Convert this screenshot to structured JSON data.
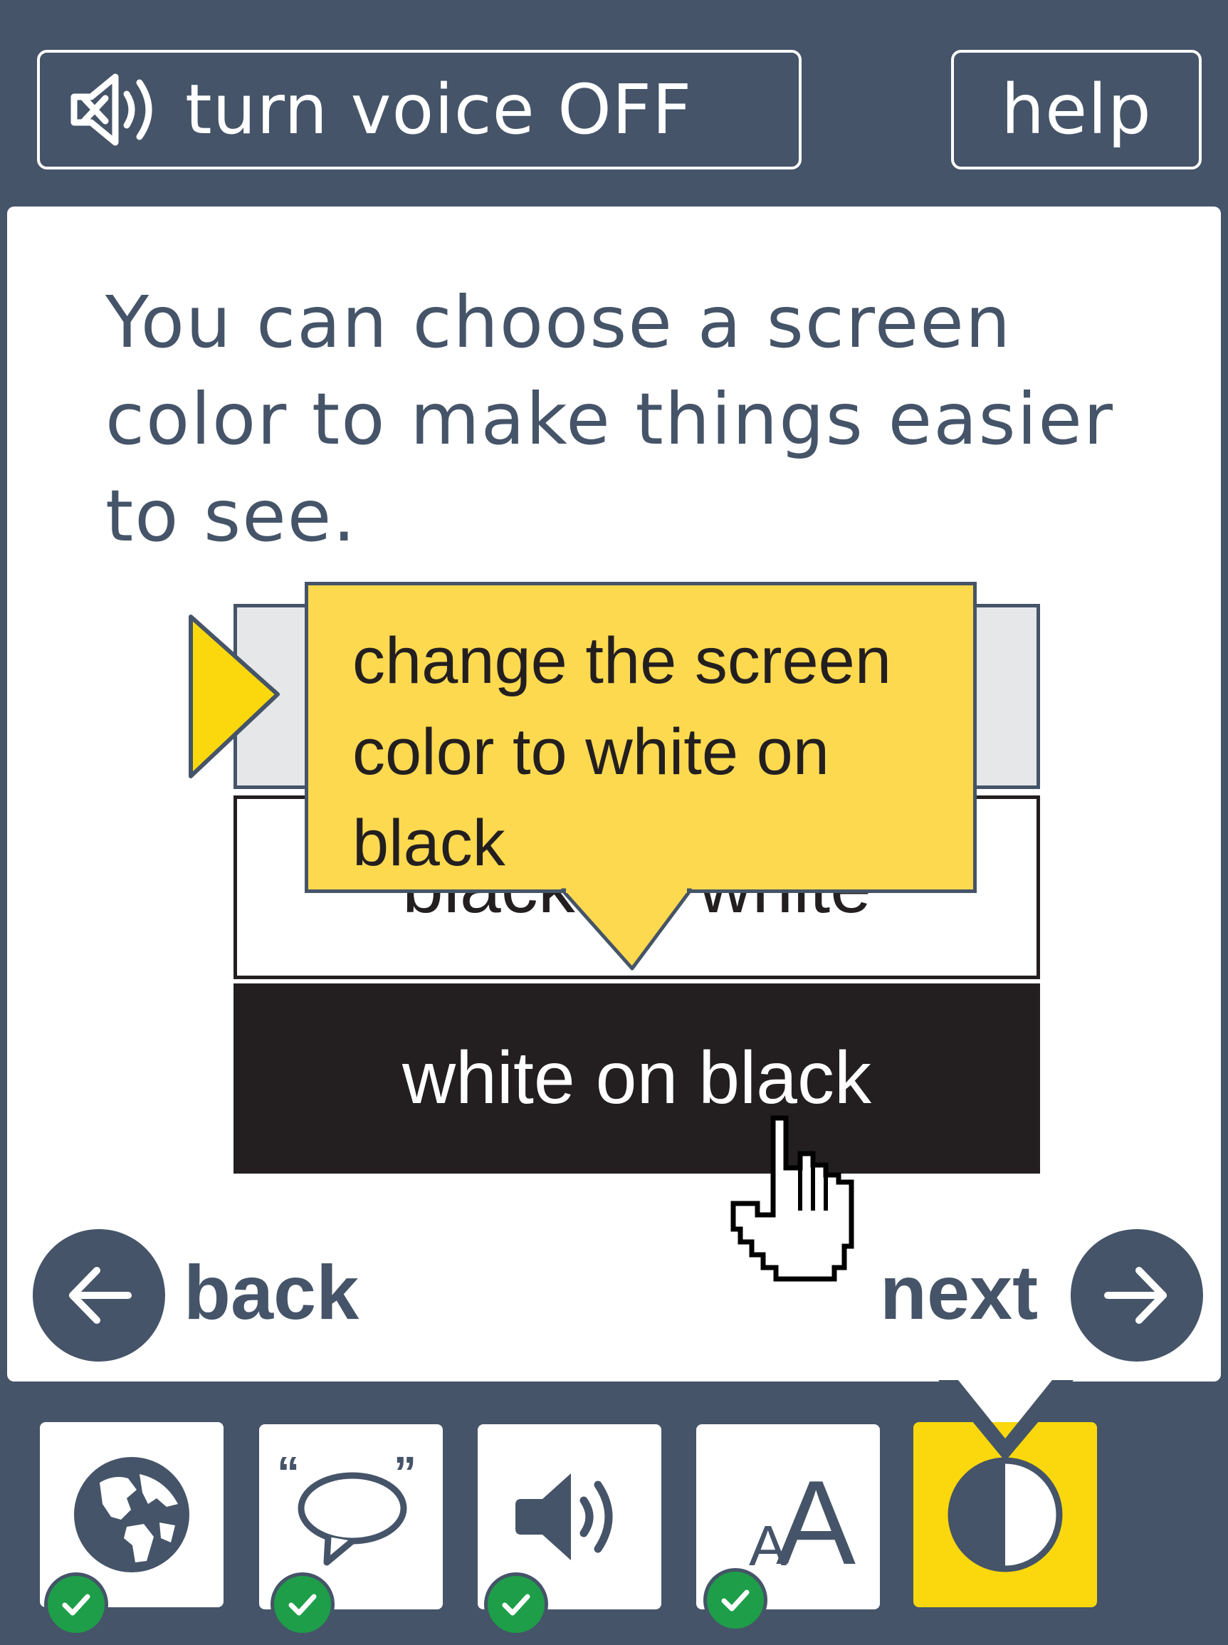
{
  "header": {
    "voice_button_label": "turn voice OFF",
    "voice_icon": "speaker-muted-icon",
    "help_label": "help"
  },
  "main": {
    "instruction": "You can choose a screen color to make things easier to see.",
    "options": [
      {
        "label": "",
        "style": "default"
      },
      {
        "label": "black on white",
        "style": "black-on-white"
      },
      {
        "label": "white on black",
        "style": "white-on-black"
      }
    ],
    "tooltip": "change the screen color to white on black"
  },
  "nav": {
    "back_label": "back",
    "next_label": "next"
  },
  "toolbar": {
    "items": [
      {
        "name": "language",
        "icon": "globe-icon",
        "completed": true
      },
      {
        "name": "speech",
        "icon": "speech-bubble-icon",
        "completed": true
      },
      {
        "name": "audio",
        "icon": "speaker-icon",
        "completed": true
      },
      {
        "name": "text-size",
        "icon": "text-size-icon",
        "small_glyph": "A",
        "big_glyph": "A",
        "completed": true
      },
      {
        "name": "contrast",
        "icon": "contrast-icon",
        "completed": false,
        "active": true
      }
    ]
  },
  "colors": {
    "frame": "#455468",
    "accent_yellow": "#fbd80d",
    "tooltip_yellow": "#fdd94f",
    "dark": "#231f20",
    "check_green": "#1e9e48"
  }
}
